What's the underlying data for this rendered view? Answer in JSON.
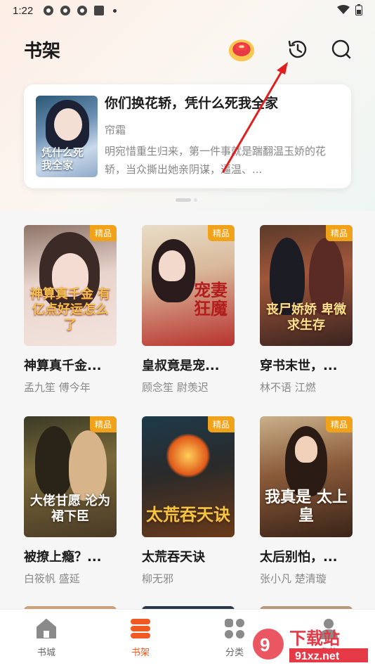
{
  "status": {
    "time": "1:22"
  },
  "header": {
    "title": "书架"
  },
  "featured": {
    "title": "你们换花轿，凭什么死我全家",
    "author": "帘霜",
    "description": "明宛惜重生归来，第一件事就是踹翻温玉娇的花轿，当众撕出她亲阴谋，逼温、...",
    "cover_text": "凭什么死我全家"
  },
  "books": [
    {
      "title": "神算真千金...",
      "author": "孟九笙  傅今年",
      "badge": "精品",
      "cover_text": "神算真千金 有亿点好运怎么了"
    },
    {
      "title": "皇叔竟是宠...",
      "author": "顾念笙  尉羡迟",
      "badge": "精品",
      "cover_text": "宠妻狂魔"
    },
    {
      "title": "穿书末世，...",
      "author": "林不语  江燃",
      "badge": "精品",
      "cover_text": "丧尸娇娇 卑微求生存"
    },
    {
      "title": "被撩上瘾？...",
      "author": "白筱帆  盛延",
      "badge": "精品",
      "cover_text": "大佬甘愿 沦为裙下臣"
    },
    {
      "title": "太荒吞天诀",
      "author": "柳无邪",
      "badge": "精品",
      "cover_text": "太荒吞天诀"
    },
    {
      "title": "太后别怕，...",
      "author": "张小凡  楚清璇",
      "badge": "精品",
      "cover_text": "我真是 太上皇"
    }
  ],
  "nav": [
    {
      "label": "书城"
    },
    {
      "label": "书架"
    },
    {
      "label": "分类"
    },
    {
      "label": "我的"
    }
  ],
  "watermark": {
    "text": "下载站",
    "url_text": "91xz.net"
  },
  "colors": {
    "accent": "#f05a22",
    "badge": "#f0a21a",
    "annotation_arrow": "#e02020"
  }
}
